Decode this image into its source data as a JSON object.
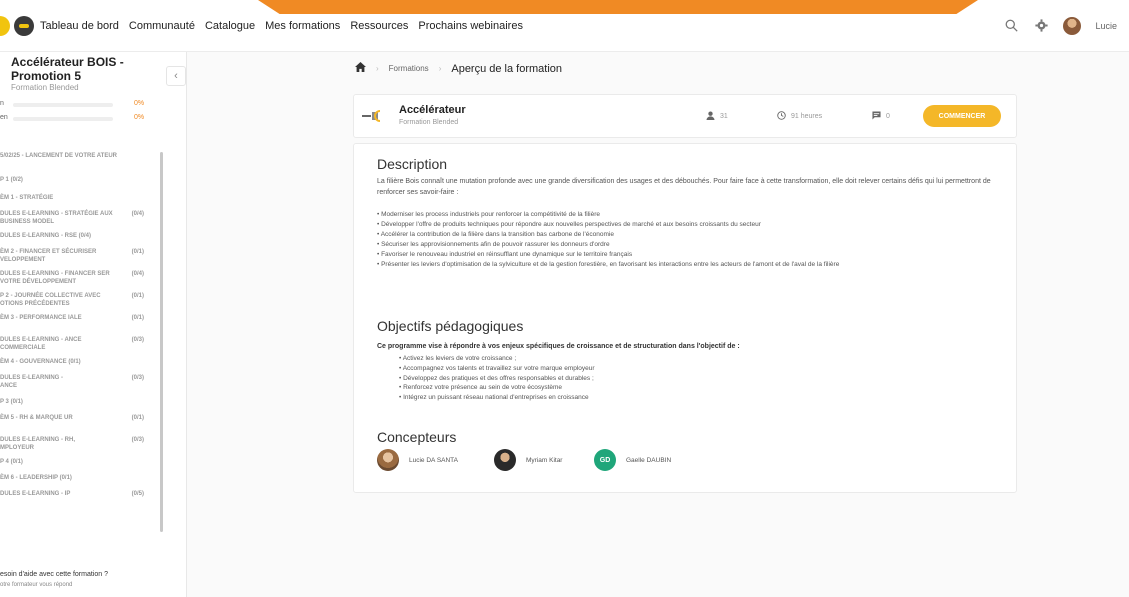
{
  "nav": {
    "links": [
      "Tableau de bord",
      "Communauté",
      "Catalogue",
      "Mes formations",
      "Ressources",
      "Prochains webinaires"
    ],
    "user_name": "Lucie"
  },
  "sidebar": {
    "title": "Accélérateur BOIS - Promotion 5",
    "subtitle": "Formation Blended",
    "progress": [
      {
        "label": "n",
        "percent": "0%"
      },
      {
        "label": "en",
        "percent": "0%"
      }
    ],
    "items": [
      {
        "label": "5/02/25 - LANCEMENT DE VOTRE ATEUR",
        "count": ""
      },
      {
        "label": "P 1 (0/2)",
        "count": ""
      },
      {
        "label": "ÈM 1 - STRATÉGIE",
        "count": ""
      },
      {
        "label": "DULES E-LEARNING - STRATÉGIE AUX BUSINESS MODEL",
        "count": "(0/4)"
      },
      {
        "label": "DULES E-LEARNING - RSE (0/4)",
        "count": ""
      },
      {
        "label": "ÈM 2 - FINANCER ET SÉCURISER VELOPPEMENT",
        "count": "(0/1)"
      },
      {
        "label": "DULES E-LEARNING - FINANCER SER VOTRE DÉVELOPPEMENT",
        "count": "(0/4)"
      },
      {
        "label": "P 2 - JOURNÉE COLLECTIVE AVEC OTIONS PRÉCÉDENTES",
        "count": "(0/1)"
      },
      {
        "label": "ÈM 3 - PERFORMANCE IALE",
        "count": "(0/1)"
      },
      {
        "label": "DULES E-LEARNING - ANCE COMMERCIALE",
        "count": "(0/3)"
      },
      {
        "label": "ÈM 4 - GOUVERNANCE (0/1)",
        "count": ""
      },
      {
        "label": "DULES E-LEARNING - ANCE",
        "count": "(0/3)"
      },
      {
        "label": "P 3 (0/1)",
        "count": ""
      },
      {
        "label": "ÈM 5 - RH & MARQUE UR",
        "count": "(0/1)"
      },
      {
        "label": "DULES E-LEARNING - RH, MPLOYEUR",
        "count": "(0/3)"
      },
      {
        "label": "P 4 (0/1)",
        "count": ""
      },
      {
        "label": "ÈM 6 - LEADERSHIP (0/1)",
        "count": ""
      },
      {
        "label": "DULES E-LEARNING - IP",
        "count": "(0/5)"
      }
    ],
    "help_title": "esoin d'aide avec cette formation ?",
    "help_sub": "otre formateur vous répond"
  },
  "breadcrumb": {
    "link": "Formations",
    "current": "Aperçu de la formation"
  },
  "card": {
    "title": "Accélérateur",
    "subtitle": "Formation Blended",
    "learners": "31",
    "duration": "91 heures",
    "comments": "0",
    "start_label": "COMMENCER"
  },
  "description": {
    "heading": "Description",
    "text": "La filière Bois connaît une mutation profonde avec une grande diversification des usages et des débouchés. Pour faire face à cette transformation, elle doit relever certains défis qui lui permettront de renforcer ses savoir-faire :",
    "bullets": [
      "• Moderniser les process industriels pour renforcer la compétitivité de la filière",
      "• Développer l'offre de produits techniques pour répondre aux nouvelles perspectives de marché et aux besoins croissants du secteur",
      "• Accélérer la contribution de la filière dans la transition bas carbone de l'économie",
      "• Sécuriser les approvisionnements afin de pouvoir rassurer les donneurs d'ordre",
      "• Favoriser le renouveau industriel en réinsufflant une dynamique sur le territoire français",
      "• Présenter les leviers d'optimisation de la sylviculture et de la gestion forestière, en favorisant les interactions entre les acteurs de l'amont et de l'aval de la filière"
    ]
  },
  "objectives": {
    "heading": "Objectifs pédagogiques",
    "intro": "Ce programme vise à répondre à vos enjeux spécifiques de croissance et de structuration dans l'objectif de :",
    "items": [
      "•   Activez les leviers de votre croissance ;",
      "•   Accompagnez vos talents et travaillez sur votre marque employeur",
      "•   Développez des pratiques et des offres responsables et durables  ;",
      "•   Renforcez votre présence au sein de votre écosystème",
      "•   Intégrez un puissant réseau national d'entreprises en croissance"
    ]
  },
  "designers": {
    "heading": "Concepteurs",
    "people": [
      {
        "name": "Lucie DA SANTA"
      },
      {
        "name": "Myriam Kitar"
      },
      {
        "name": "Gaelle DAUBIN",
        "initials": "GD"
      }
    ]
  },
  "colors": {
    "accent": "#f08a24",
    "button": "#f4b728",
    "initials_bg": "#1fa67a"
  }
}
